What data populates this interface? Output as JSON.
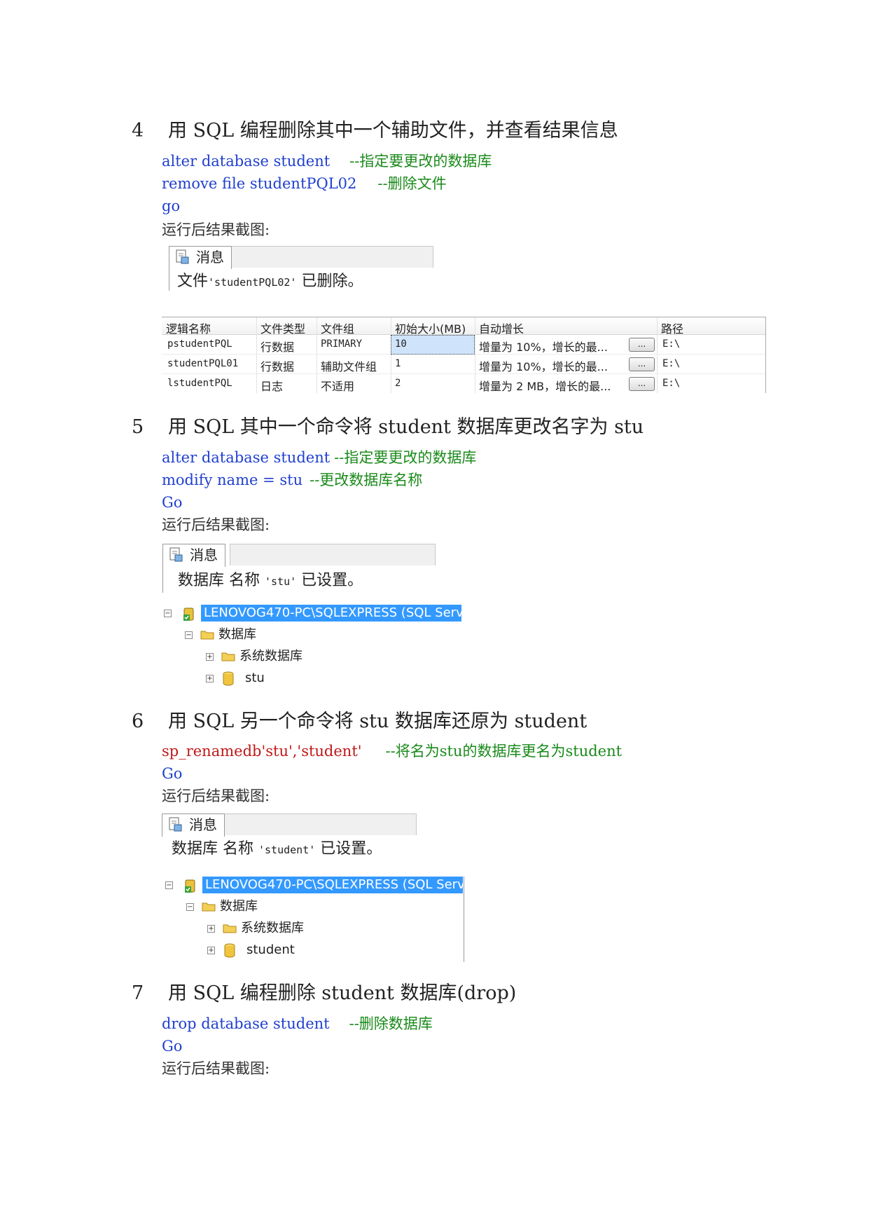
{
  "sections": [
    {
      "num": "4",
      "title": "用 SQL  编程删除其中一个辅助文件，并查看结果信息"
    },
    {
      "num": "5",
      "title": "用 SQL  其中一个命令将 student 数据库更改名字为 stu"
    },
    {
      "num": "6",
      "title": "用 SQL  另一个命令将 stu 数据库还原为 student"
    },
    {
      "num": "7",
      "title": "用 SQL  编程删除 student 数据库(drop)"
    }
  ],
  "code4": {
    "l1_code": "alter database student",
    "l1_comment": "--指定要更改的数据库",
    "l2_code": "remove file studentPQL02",
    "l2_comment": "--删除文件",
    "l3_code": "go"
  },
  "code5": {
    "l1_code": "alter database student",
    "l1_comment": "--指定要更改的数据库",
    "l2_code": "modify name = stu",
    "l2_comment": "--更改数据库名称",
    "l3_code": "Go"
  },
  "code6": {
    "l1_code": "sp_renamedb'stu','student'",
    "l1_comment": "--将名为stu的数据库更名为student",
    "l2_code": "Go"
  },
  "code7": {
    "l1_code": "drop database student",
    "l1_comment": "--删除数据库",
    "l2_code": "Go"
  },
  "caption": "运行后结果截图:",
  "msg_tab": "消息",
  "msg4": {
    "pre": "文件",
    "mono": "'studentPQL02'",
    "post": " 已删除。"
  },
  "msg5": {
    "pre": "数据库 名称 ",
    "mono": "'stu'",
    "post": " 已设置。"
  },
  "msg6": {
    "pre": "数据库 名称 ",
    "mono": "'student'",
    "post": " 已设置。"
  },
  "file_table": {
    "headers": [
      "逻辑名称",
      "文件类型",
      "文件组",
      "初始大小(MB)",
      "自动增长",
      "路径"
    ],
    "rows": [
      {
        "name": "pstudentPQL",
        "type": "行数据",
        "group": "PRIMARY",
        "size": "10",
        "growth": "增量为 10%，增长的最...",
        "path": "E:\\"
      },
      {
        "name": "studentPQL01",
        "type": "行数据",
        "group": "辅助文件组",
        "size": "1",
        "growth": "增量为 10%，增长的最...",
        "path": "E:\\"
      },
      {
        "name": "lstudentPQL",
        "type": "日志",
        "group": "不适用",
        "size": "2",
        "growth": "增量为 2 MB，增长的最...",
        "path": "E:\\"
      }
    ],
    "button": "..."
  },
  "tree5": {
    "server": "LENOVOG470-PC\\SQLEXPRESS (SQL Serv",
    "databases": "数据库",
    "system_db": "系统数据库",
    "db": "stu"
  },
  "tree6": {
    "server": "LENOVOG470-PC\\SQLEXPRESS (SQL Serv",
    "databases": "数据库",
    "system_db": "系统数据库",
    "db": "student"
  }
}
